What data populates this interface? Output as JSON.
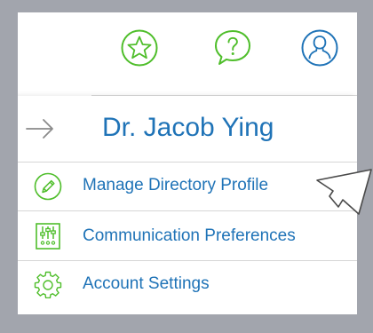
{
  "colors": {
    "accent_green": "#4fbe2b",
    "link_blue": "#1f73b7",
    "divider": "#d6d6d6",
    "backdrop": "#a2a5ad"
  },
  "header": {
    "icons": [
      "star-icon",
      "help-icon",
      "profile-icon"
    ]
  },
  "menu": {
    "user_name": "Dr. Jacob Ying",
    "back_icon": "arrow-right-icon",
    "items": [
      {
        "label": "Manage Directory Profile",
        "icon": "pencil-icon"
      },
      {
        "label": "Communication Preferences",
        "icon": "sliders-icon"
      },
      {
        "label": "Account Settings",
        "icon": "gear-icon"
      }
    ]
  }
}
